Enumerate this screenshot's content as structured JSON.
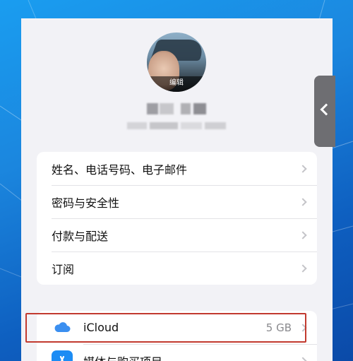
{
  "profile": {
    "avatar_edit_label": "编辑"
  },
  "account_group": {
    "items": [
      {
        "label": "姓名、电话号码、电子邮件"
      },
      {
        "label": "密码与安全性"
      },
      {
        "label": "付款与配送"
      },
      {
        "label": "订阅"
      }
    ]
  },
  "services_group": {
    "items": [
      {
        "label": "iCloud",
        "value": "5 GB",
        "icon": "icloud-icon"
      },
      {
        "label": "媒体与购买项目",
        "icon": "app-store-icon"
      }
    ]
  },
  "colors": {
    "highlight_border": "#c23a2f",
    "icloud_blue": "#3b8ff0",
    "app_store_blue": "#1c8cf4"
  }
}
